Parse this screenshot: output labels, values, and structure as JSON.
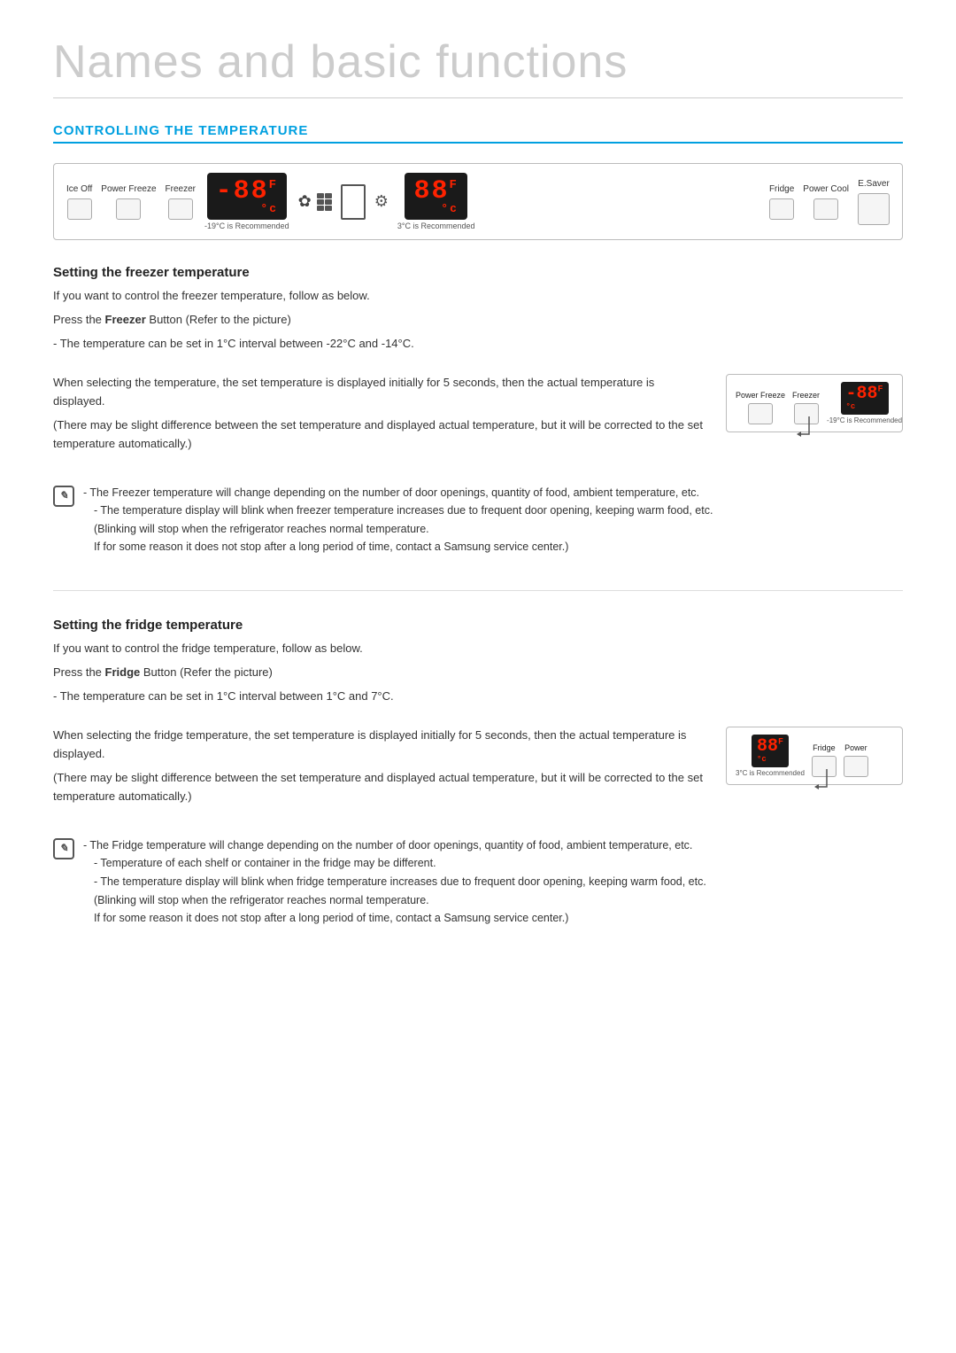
{
  "page": {
    "title": "Names and basic functions",
    "section_heading": "CONTROLLING THE TEMPERATURE"
  },
  "control_panel": {
    "left_labels": [
      "Ice Off",
      "Power Freeze",
      "Freezer"
    ],
    "freezer_recommended": "-19°C is Recommended",
    "fridge_recommended": "3°C is Recommended",
    "right_labels": [
      "Fridge",
      "Power Cool",
      "E.Saver"
    ],
    "temp_display_freezer": "-88",
    "temp_display_fridge": "88",
    "temp_unit_f": "F",
    "temp_unit_c": "°c"
  },
  "freezer_section": {
    "title": "Setting the freezer temperature",
    "intro": "If you want to control the freezer temperature, follow as below.",
    "instruction_prefix": "Press the ",
    "instruction_button": "Freezer",
    "instruction_suffix": " Button (Refer to the picture)",
    "temp_range": "- The temperature can be set in 1°C interval between -22°C and -14°C.",
    "display_note": "When selecting the temperature, the set temperature is displayed initially for 5 seconds, then the actual temperature is displayed.",
    "display_note2": "(There may be slight difference between the set temperature and displayed actual temperature, but it will be corrected to the set temperature automatically.)",
    "notes": [
      "- The Freezer temperature will change depending on the number of door openings, quantity of food, ambient temperature, etc.",
      "- The temperature display will blink when freezer temperature increases due to frequent door opening, keeping warm food, etc.",
      "(Blinking will stop when the refrigerator reaches normal temperature.",
      " If for some reason it does not stop after a long period of time, contact a Samsung service center.)"
    ]
  },
  "fridge_section": {
    "title": "Setting the fridge temperature",
    "intro": "If you want to control the fridge temperature, follow as below.",
    "instruction_prefix": "Press the ",
    "instruction_button": "Fridge",
    "instruction_suffix": " Button (Refer the picture)",
    "temp_range": "- The temperature can be set in 1°C interval between 1°C and 7°C.",
    "display_note": "When selecting the fridge temperature, the set temperature is displayed initially for 5 seconds, then the actual temperature is displayed.",
    "display_note2": "(There may be slight difference between the set temperature and displayed actual temperature, but it will be corrected to the set temperature automatically.)",
    "notes": [
      "- The Fridge temperature will change depending on the number of door openings, quantity of food, ambient temperature, etc.",
      "- Temperature of each shelf or container in the fridge may be different.",
      "- The temperature display will blink when fridge temperature increases due to frequent door opening, keeping warm food, etc.",
      "(Blinking will stop when the refrigerator reaches normal temperature.",
      " If for some reason it does not stop after a long period of time, contact a Samsung service center.)"
    ]
  }
}
